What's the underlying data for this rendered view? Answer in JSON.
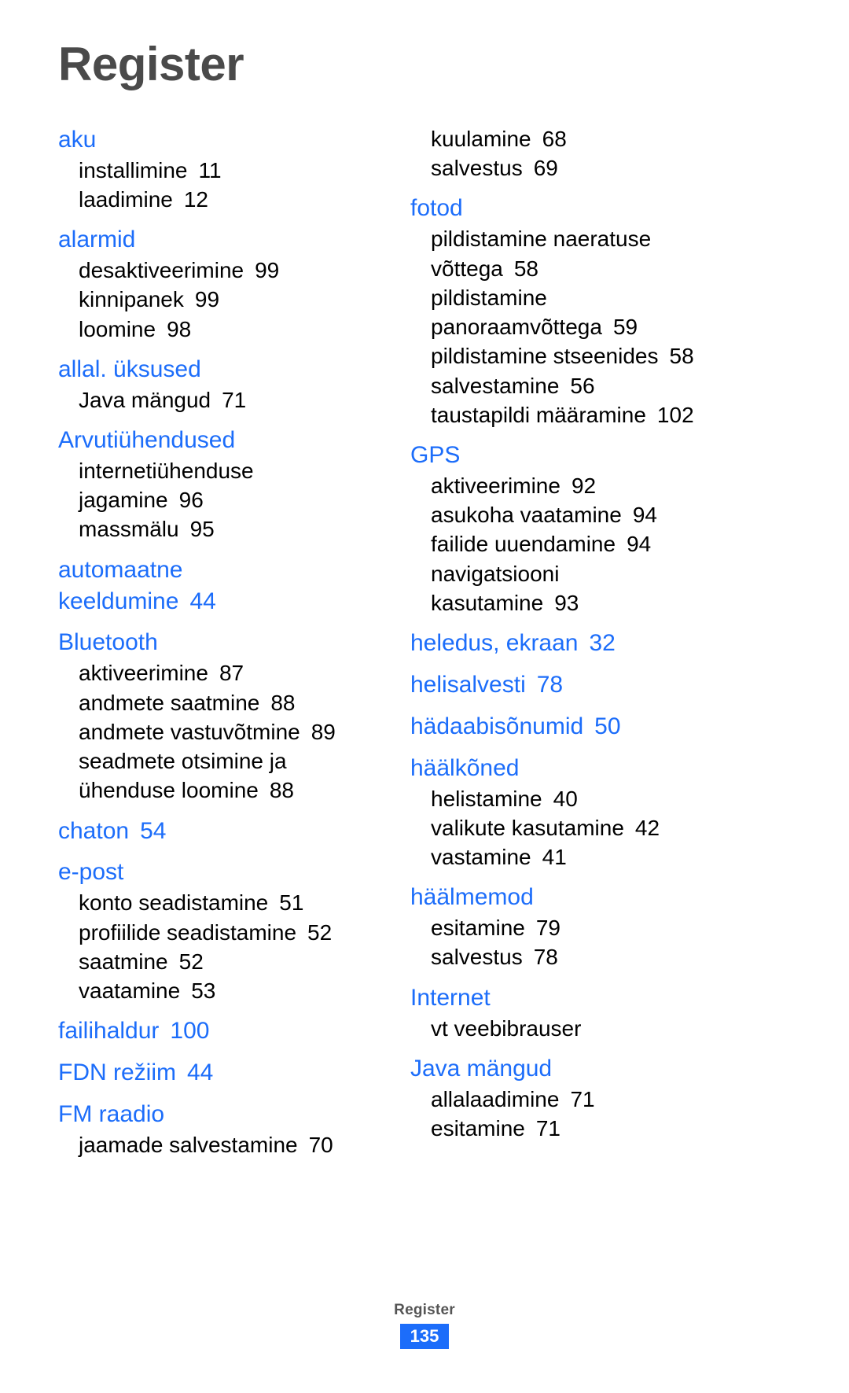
{
  "document": {
    "title": "Register",
    "footer_label": "Register",
    "page_number": "135",
    "accent_color": "#1c6dfa",
    "title_color": "#4a4a4a",
    "body_color": "#000000"
  },
  "columns": [
    {
      "name": "left-column",
      "entries": [
        {
          "type": "heading",
          "label": "aku",
          "page": ""
        },
        {
          "type": "sub",
          "label": "installimine",
          "page": "11"
        },
        {
          "type": "sub",
          "label": "laadimine",
          "page": "12"
        },
        {
          "type": "heading",
          "label": "alarmid",
          "page": ""
        },
        {
          "type": "sub",
          "label": "desaktiveerimine",
          "page": "99"
        },
        {
          "type": "sub",
          "label": "kinnipanek",
          "page": "99"
        },
        {
          "type": "sub",
          "label": "loomine",
          "page": "98"
        },
        {
          "type": "heading",
          "label": "allal. üksused",
          "page": ""
        },
        {
          "type": "sub",
          "label": "Java mängud",
          "page": "71"
        },
        {
          "type": "heading",
          "label": "Arvutiühendused",
          "page": ""
        },
        {
          "type": "sub",
          "label": "internetiühenduse\njagamine",
          "page": "96"
        },
        {
          "type": "sub",
          "label": "massmälu",
          "page": "95"
        },
        {
          "type": "heading",
          "label": "automaatne\nkeeldumine",
          "page": "44"
        },
        {
          "type": "heading",
          "label": "Bluetooth",
          "page": ""
        },
        {
          "type": "sub",
          "label": "aktiveerimine",
          "page": "87"
        },
        {
          "type": "sub",
          "label": "andmete saatmine",
          "page": "88"
        },
        {
          "type": "sub",
          "label": "andmete vastuvõtmine",
          "page": "89"
        },
        {
          "type": "sub",
          "label": "seadmete otsimine ja\nühenduse loomine",
          "page": "88"
        },
        {
          "type": "heading",
          "label": "chaton",
          "page": "54"
        },
        {
          "type": "heading",
          "label": "e-post",
          "page": ""
        },
        {
          "type": "sub",
          "label": "konto seadistamine",
          "page": "51"
        },
        {
          "type": "sub",
          "label": "profiilide seadistamine",
          "page": "52"
        },
        {
          "type": "sub",
          "label": "saatmine",
          "page": "52"
        },
        {
          "type": "sub",
          "label": "vaatamine",
          "page": "53"
        },
        {
          "type": "heading",
          "label": "failihaldur",
          "page": "100"
        },
        {
          "type": "heading",
          "label": "FDN režiim",
          "page": "44"
        },
        {
          "type": "heading",
          "label": "FM raadio",
          "page": ""
        },
        {
          "type": "sub",
          "label": "jaamade salvestamine",
          "page": "70"
        }
      ]
    },
    {
      "name": "right-column",
      "entries": [
        {
          "type": "sub",
          "label": "kuulamine",
          "page": "68"
        },
        {
          "type": "sub",
          "label": "salvestus",
          "page": "69"
        },
        {
          "type": "heading",
          "label": "fotod",
          "page": ""
        },
        {
          "type": "sub",
          "label": "pildistamine naeratuse\nvõttega",
          "page": "58"
        },
        {
          "type": "sub",
          "label": "pildistamine\npanoraamvõttega",
          "page": "59"
        },
        {
          "type": "sub",
          "label": "pildistamine stseenides",
          "page": "58"
        },
        {
          "type": "sub",
          "label": "salvestamine",
          "page": "56"
        },
        {
          "type": "sub",
          "label": "taustapildi määramine",
          "page": "102"
        },
        {
          "type": "heading",
          "label": "GPS",
          "page": ""
        },
        {
          "type": "sub",
          "label": "aktiveerimine",
          "page": "92"
        },
        {
          "type": "sub",
          "label": "asukoha vaatamine",
          "page": "94"
        },
        {
          "type": "sub",
          "label": "failide uuendamine",
          "page": "94"
        },
        {
          "type": "sub",
          "label": "navigatsiooni\nkasutamine",
          "page": "93"
        },
        {
          "type": "heading",
          "label": "heledus, ekraan",
          "page": "32"
        },
        {
          "type": "heading",
          "label": "helisalvesti",
          "page": "78"
        },
        {
          "type": "heading",
          "label": "hädaabisõnumid",
          "page": "50"
        },
        {
          "type": "heading",
          "label": "häälkõned",
          "page": ""
        },
        {
          "type": "sub",
          "label": "helistamine",
          "page": "40"
        },
        {
          "type": "sub",
          "label": "valikute kasutamine",
          "page": "42"
        },
        {
          "type": "sub",
          "label": "vastamine",
          "page": "41"
        },
        {
          "type": "heading",
          "label": "häälmemod",
          "page": ""
        },
        {
          "type": "sub",
          "label": "esitamine",
          "page": "79"
        },
        {
          "type": "sub",
          "label": "salvestus",
          "page": "78"
        },
        {
          "type": "heading",
          "label": "Internet",
          "page": ""
        },
        {
          "type": "sub",
          "label": "vt veebibrauser",
          "page": ""
        },
        {
          "type": "heading",
          "label": "Java mängud",
          "page": ""
        },
        {
          "type": "sub",
          "label": "allalaadimine",
          "page": "71"
        },
        {
          "type": "sub",
          "label": "esitamine",
          "page": "71"
        }
      ]
    }
  ]
}
